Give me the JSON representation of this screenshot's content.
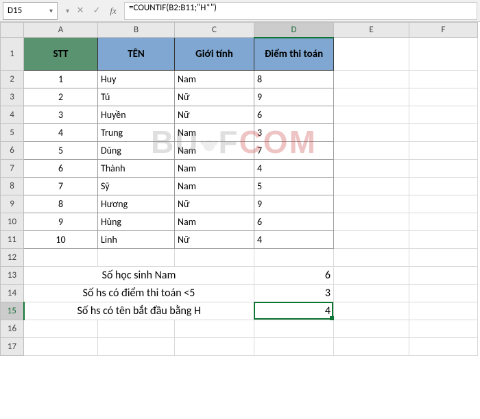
{
  "name_box": "D15",
  "formula": "=COUNTIF(B2:B11;\"H*\")",
  "col_headers": [
    "A",
    "B",
    "C",
    "D",
    "E",
    "F"
  ],
  "active_col_index": 3,
  "row_headers": [
    "1",
    "2",
    "3",
    "4",
    "5",
    "6",
    "7",
    "8",
    "9",
    "10",
    "11",
    "12",
    "13",
    "14",
    "15",
    "16",
    "17"
  ],
  "active_row_index": 14,
  "table_headers": {
    "a": "STT",
    "b": "TÊN",
    "c": "Giới tính",
    "d": "Điểm thi toán"
  },
  "rows": [
    {
      "stt": "1",
      "ten": "Huy",
      "gt": "Nam",
      "diem": "8"
    },
    {
      "stt": "2",
      "ten": "Tú",
      "gt": "Nữ",
      "diem": "9"
    },
    {
      "stt": "3",
      "ten": "Huyền",
      "gt": "Nữ",
      "diem": "6"
    },
    {
      "stt": "4",
      "ten": "Trung",
      "gt": "Nam",
      "diem": "3"
    },
    {
      "stt": "5",
      "ten": "Dũng",
      "gt": "Nam",
      "diem": "7"
    },
    {
      "stt": "6",
      "ten": "Thành",
      "gt": "Nam",
      "diem": "4"
    },
    {
      "stt": "7",
      "ten": "Sỹ",
      "gt": "Nam",
      "diem": "5"
    },
    {
      "stt": "8",
      "ten": "Hương",
      "gt": "Nữ",
      "diem": "9"
    },
    {
      "stt": "9",
      "ten": "Hùng",
      "gt": "Nam",
      "diem": "6"
    },
    {
      "stt": "10",
      "ten": "Linh",
      "gt": "Nữ",
      "diem": "4"
    }
  ],
  "summary": [
    {
      "label": "Số học sinh Nam",
      "value": "6"
    },
    {
      "label": "Số hs có điểm thi toán <5",
      "value": "3"
    },
    {
      "label": "Số hs có tên bắt đầu bằng H",
      "value": "4"
    }
  ],
  "watermark": {
    "pre": "BU",
    "mid": "F",
    "post": "COM"
  },
  "icons": {
    "dropdown": "▾",
    "x": "✕",
    "check": "✓",
    "fx": "fx"
  }
}
